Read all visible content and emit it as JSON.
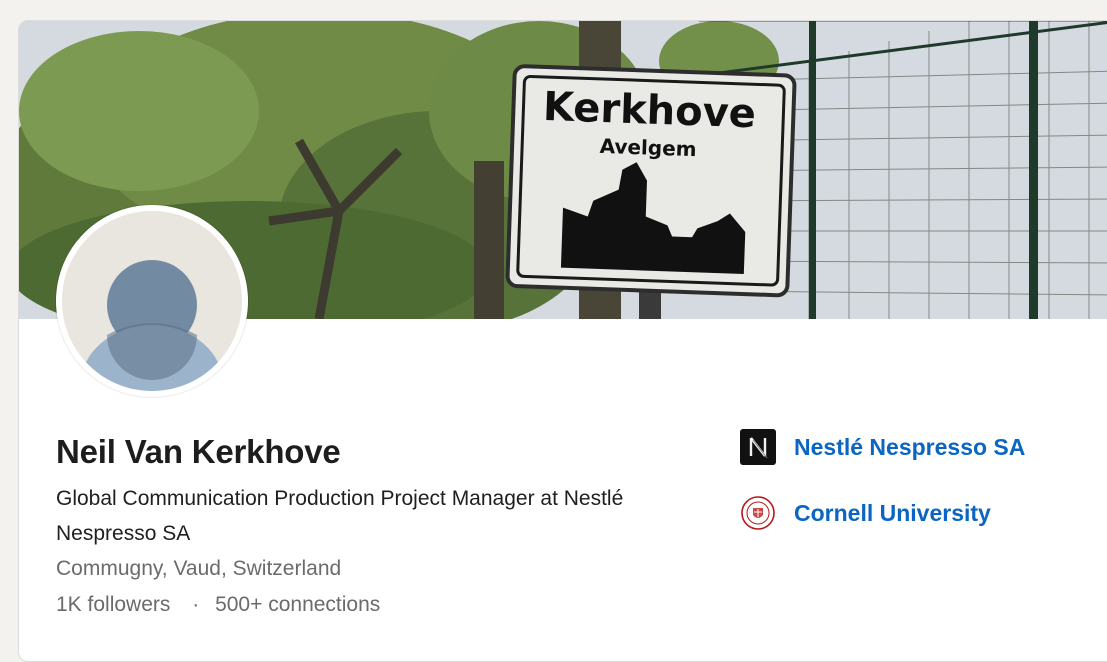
{
  "banner": {
    "sign_title": "Kerkhove",
    "sign_subtitle": "Avelgem"
  },
  "profile": {
    "name": "Neil Van Kerkhove",
    "headline": "Global Communication Production Project Manager at Nestlé Nespresso SA",
    "location": "Commugny, Vaud, Switzerland",
    "followers": "1K followers",
    "separator": "·",
    "connections": "500+ connections"
  },
  "organizations": [
    {
      "name": "Nestlé Nespresso SA",
      "icon": "nespresso-logo-icon"
    },
    {
      "name": "Cornell University",
      "icon": "cornell-seal-icon"
    }
  ],
  "colors": {
    "link": "#0a66c2",
    "name_text": "#1d1d1d",
    "muted_text": "#6b6b6b"
  }
}
